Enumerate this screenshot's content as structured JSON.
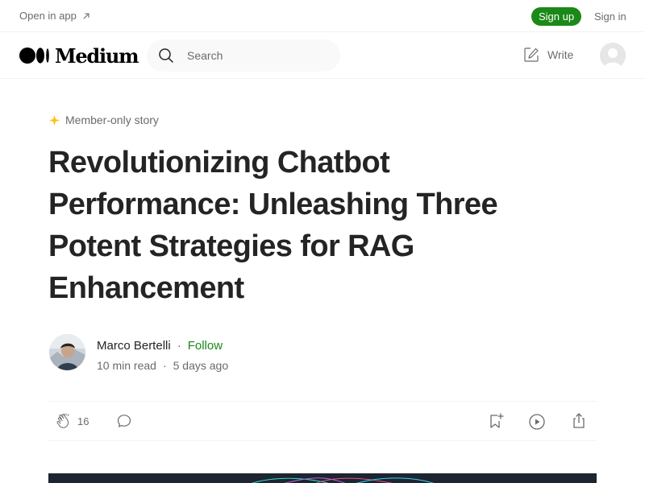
{
  "banner": {
    "open_in_app": "Open in app",
    "sign_up": "Sign up",
    "sign_in": "Sign in"
  },
  "header": {
    "logo_text": "Medium",
    "search_placeholder": "Search",
    "write_label": "Write"
  },
  "article": {
    "member_badge": "Member-only story",
    "title": "Revolutionizing Chatbot Performance: Unleashing Three Potent Strategies for RAG Enhancement",
    "author": "Marco Bertelli",
    "follow_label": "Follow",
    "separator": "·",
    "read_time": "10 min read",
    "published": "5 days ago",
    "clap_count": "16"
  },
  "colors": {
    "accent_green": "#1a8917",
    "member_star": "#ffc017",
    "text_primary": "#242424",
    "text_secondary": "#6b6b6b"
  },
  "icons": [
    "arrow-up-right-icon",
    "medium-logo-icon",
    "search-icon",
    "write-icon",
    "user-avatar-icon",
    "star-icon",
    "clap-icon",
    "comment-icon",
    "bookmark-add-icon",
    "play-icon",
    "share-icon"
  ]
}
